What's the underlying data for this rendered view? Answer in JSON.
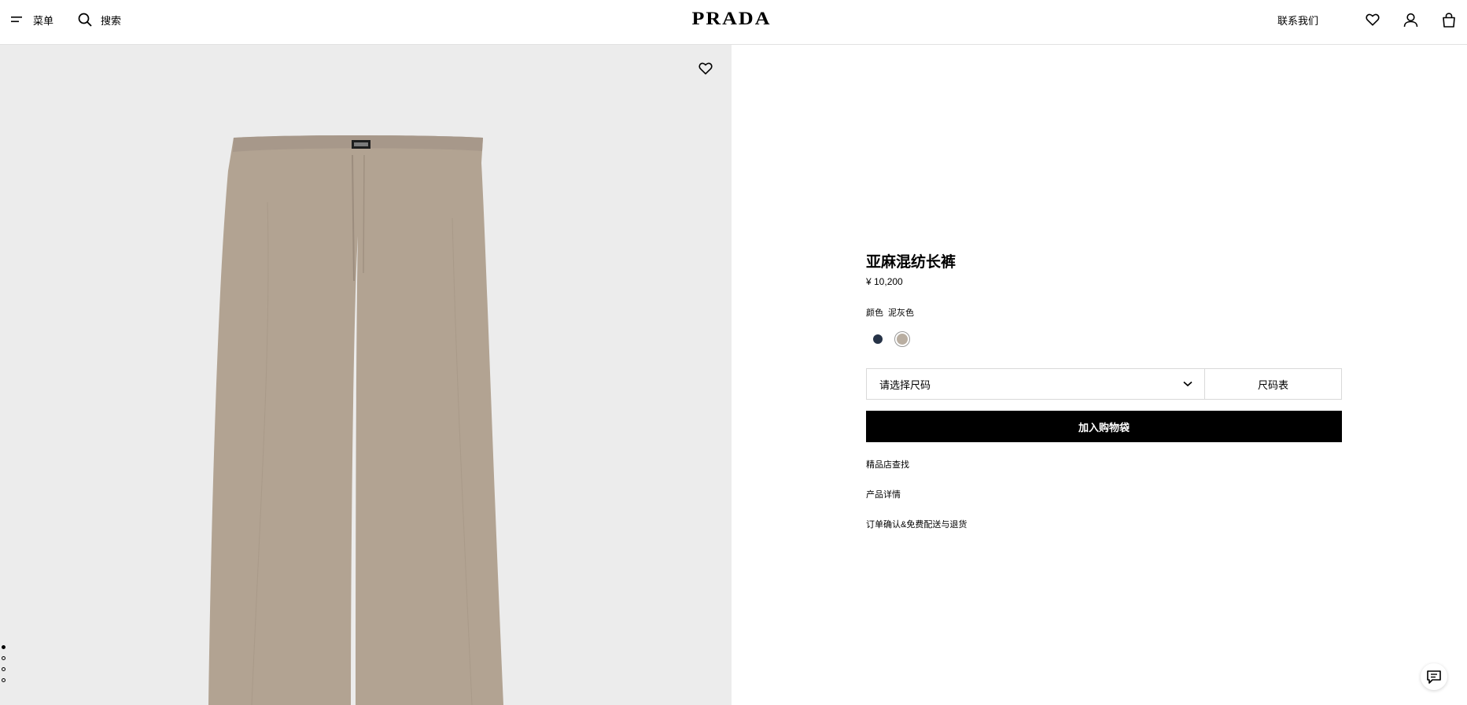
{
  "header": {
    "menu_label": "菜单",
    "menu_icon": "hamburger-icon",
    "search_label": "搜索",
    "search_icon": "search-icon",
    "logo": "PRADA",
    "contact_label": "联系我们",
    "icons": [
      "heart-icon",
      "account-icon",
      "shopping-bag-icon"
    ]
  },
  "gallery": {
    "dot_count": 4,
    "active_index": 0
  },
  "product": {
    "title": "亚麻混纺长裤",
    "price": "¥ 10,200",
    "color_label": "颜色",
    "color_selected": "泥灰色",
    "swatches": [
      {
        "color": "#263347",
        "selected": false
      },
      {
        "color": "#b9aea1",
        "selected": true
      }
    ],
    "size_placeholder": "请选择尺码",
    "size_guide_label": "尺码表",
    "add_to_bag_label": "加入购物袋",
    "links": [
      "精品店查找",
      "产品详情",
      "订单确认&免费配送与退货"
    ]
  }
}
